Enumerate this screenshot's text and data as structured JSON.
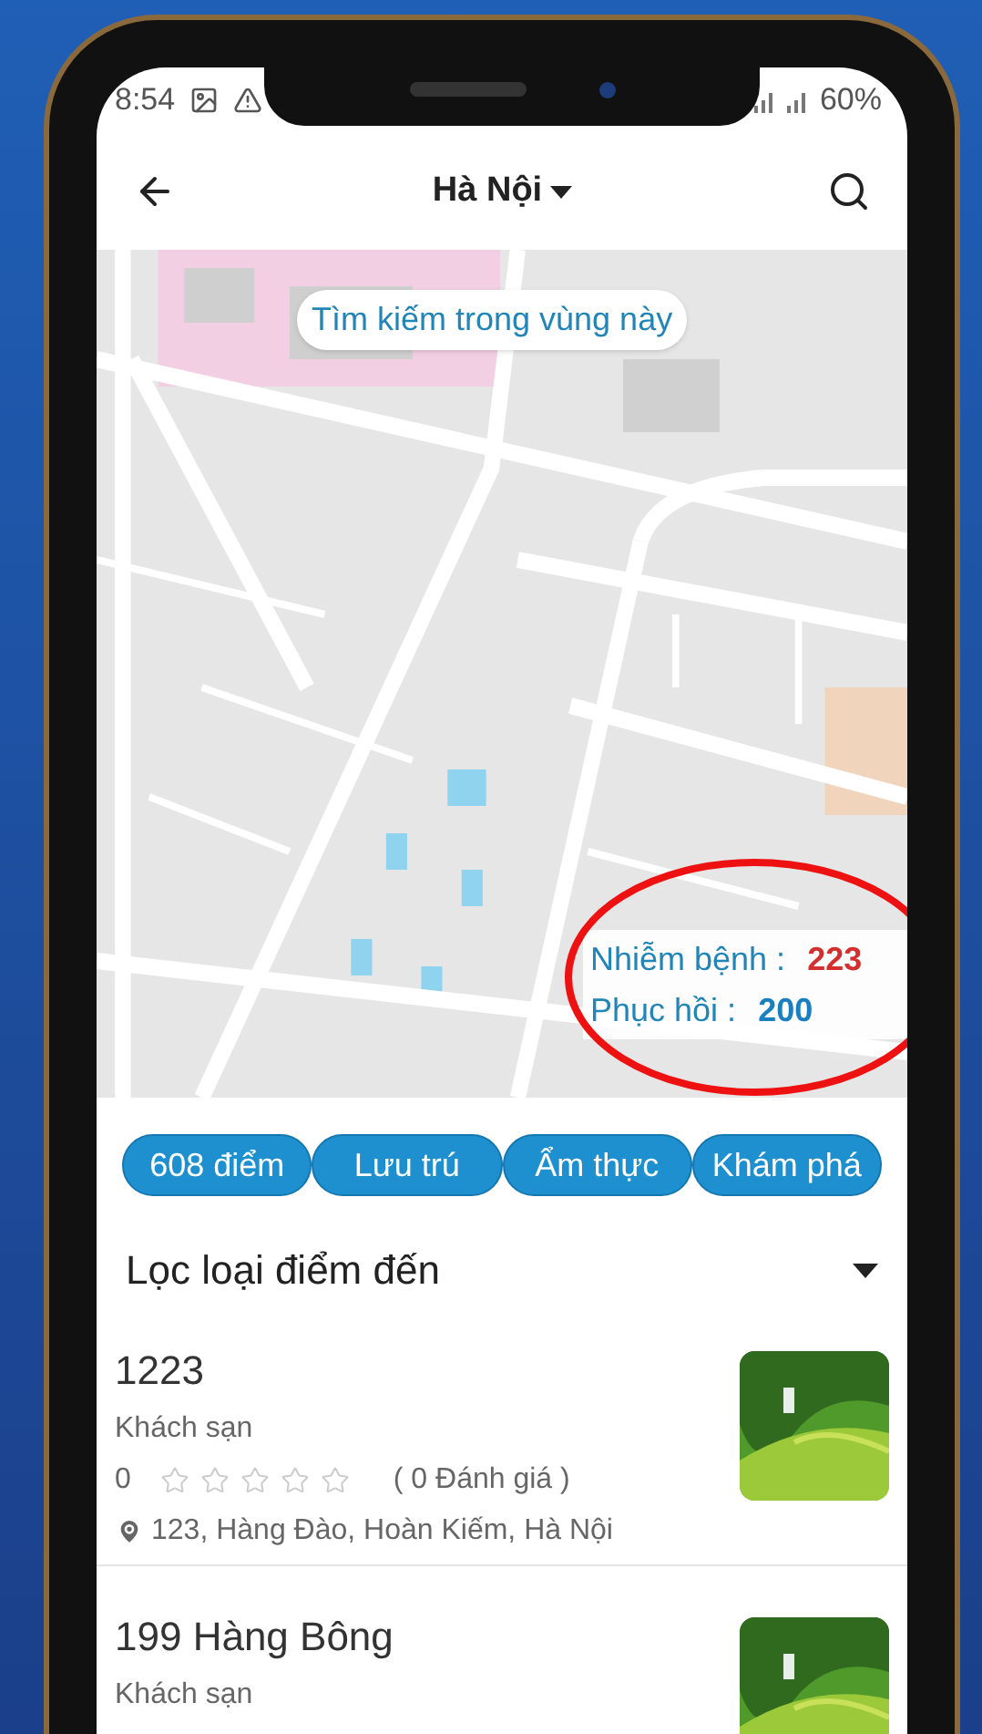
{
  "status_bar": {
    "time": "8:54",
    "battery": "60%"
  },
  "header": {
    "title": "Hà Nội"
  },
  "map": {
    "search_area_button": "Tìm kiếm trong vùng này",
    "stats": [
      {
        "label": "Nhiễm bệnh :",
        "value": "223",
        "color": "#d32f2f"
      },
      {
        "label": "Phục hồi :",
        "value": "200",
        "color": "#1a7fc0"
      }
    ]
  },
  "chips": [
    {
      "label": "608 điểm"
    },
    {
      "label": "Lưu trú"
    },
    {
      "label": "Ẩm thực"
    },
    {
      "label": "Khám phá"
    }
  ],
  "filter": {
    "label": "Lọc loại điểm đến"
  },
  "items": [
    {
      "name": "1223",
      "category": "Khách sạn",
      "rating": "0",
      "stars": 0,
      "reviews": "( 0 Đánh giá )",
      "address": "123, Hàng Đào, Hoàn Kiếm, Hà Nội"
    },
    {
      "name": "199 Hàng Bông",
      "category": "Khách sạn"
    }
  ]
}
